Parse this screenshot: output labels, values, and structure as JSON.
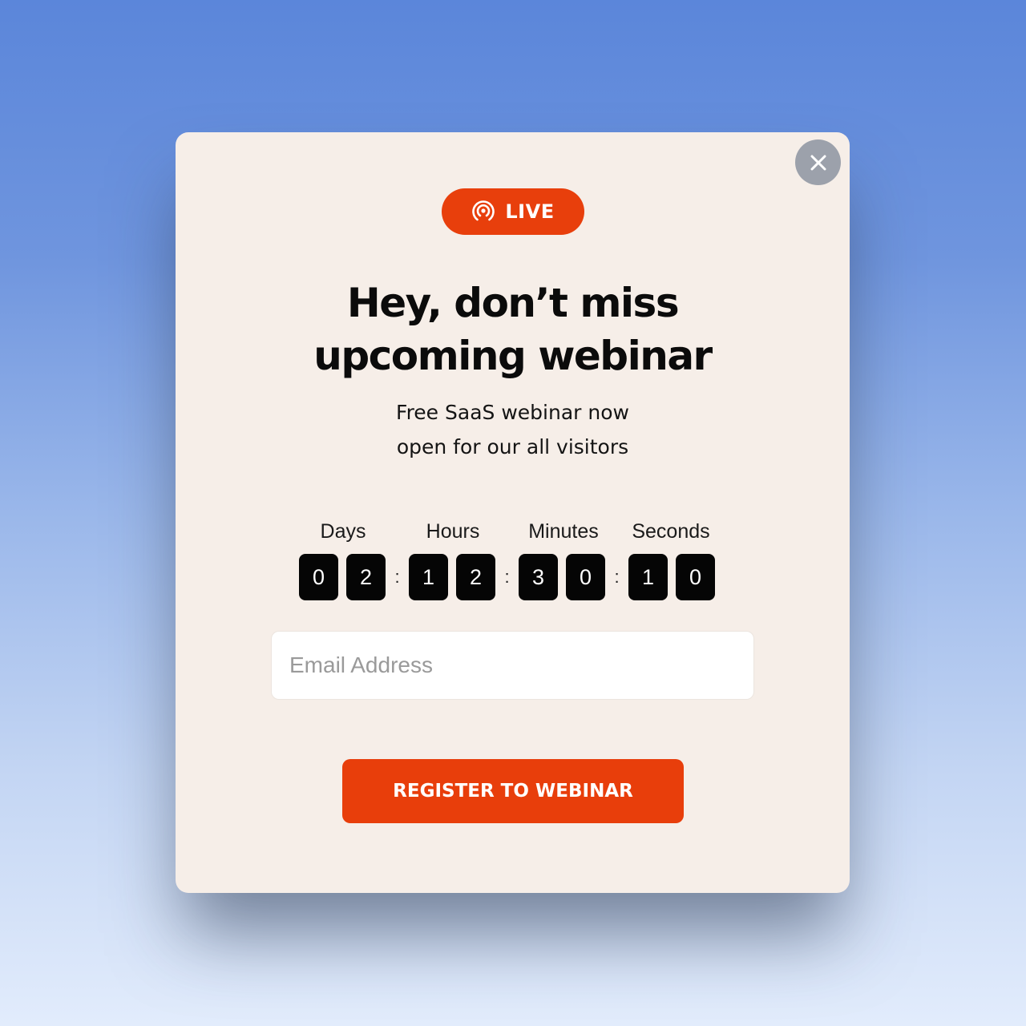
{
  "colors": {
    "accent": "#e83e0b",
    "modal_background": "#f6eee8",
    "close_button": "#9ca1ab",
    "digit_box": "#050505"
  },
  "modal": {
    "close_icon": "close-icon",
    "badge": {
      "icon": "broadcast-icon",
      "label": "LIVE"
    },
    "title_lines": [
      "Hey, don’t miss",
      "upcoming webinar"
    ],
    "subtitle_lines": [
      "Free SaaS webinar now",
      "open for our all visitors"
    ],
    "countdown": {
      "labels": [
        "Days",
        "Hours",
        "Minutes",
        "Seconds"
      ],
      "units": [
        {
          "name": "days",
          "digits": [
            "0",
            "2"
          ]
        },
        {
          "name": "hours",
          "digits": [
            "1",
            "2"
          ]
        },
        {
          "name": "minutes",
          "digits": [
            "3",
            "0"
          ]
        },
        {
          "name": "seconds",
          "digits": [
            "1",
            "0"
          ]
        }
      ],
      "separator": ":"
    },
    "email": {
      "value": "",
      "placeholder": "Email Address"
    },
    "register_label": "REGISTER TO WEBINAR"
  }
}
